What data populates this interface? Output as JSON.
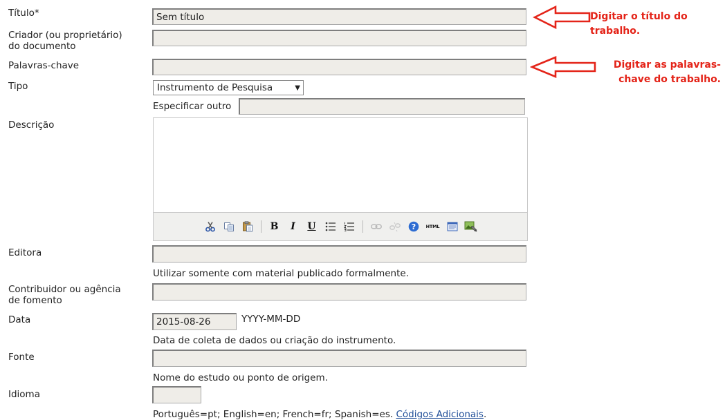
{
  "form": {
    "title": {
      "label": "Título*",
      "value": "Sem título"
    },
    "creator": {
      "label_line1": "Criador (ou proprietário)",
      "label_line2": "do documento",
      "value": ""
    },
    "keywords": {
      "label": "Palavras-chave",
      "value": ""
    },
    "type": {
      "label": "Tipo",
      "selected": "Instrumento de Pesquisa",
      "other_label": "Especificar outro",
      "other_value": ""
    },
    "description": {
      "label": "Descrição",
      "value": "",
      "toolbar": [
        "cut-icon",
        "copy-icon",
        "paste-icon",
        "|",
        "bold-icon",
        "italic-icon",
        "underline-icon",
        "bullet-list-icon",
        "numbered-list-icon",
        "|",
        "link-icon",
        "unlink-icon",
        "help-icon",
        "html-icon",
        "fullscreen-icon",
        "insert-image-icon"
      ],
      "bold_glyph": "B",
      "italic_glyph": "I",
      "underline_glyph": "U",
      "html_glyph": "HTML"
    },
    "publisher": {
      "label": "Editora",
      "value": "",
      "help": "Utilizar somente com material publicado formalmente."
    },
    "contributor": {
      "label_line1": "Contribuidor ou agência",
      "label_line2": "de fomento",
      "value": ""
    },
    "date": {
      "label": "Data",
      "value": "2015-08-26",
      "format": "YYYY-MM-DD",
      "help": "Data de coleta de dados ou criação do instrumento."
    },
    "source": {
      "label": "Fonte",
      "value": "",
      "help": "Nome do estudo ou ponto de origem."
    },
    "language": {
      "label": "Idioma",
      "value": "",
      "help": "Português=pt; English=en; French=fr; Spanish=es.",
      "link": "Códigos Adicionais",
      "help_end": "."
    }
  },
  "annotations": {
    "title_note_line1": "Digitar o título do",
    "title_note_line2": "trabalho.",
    "keywords_note_line1": "Digitar as palavras-",
    "keywords_note_line2": "chave do trabalho.",
    "color": "#e42419"
  }
}
